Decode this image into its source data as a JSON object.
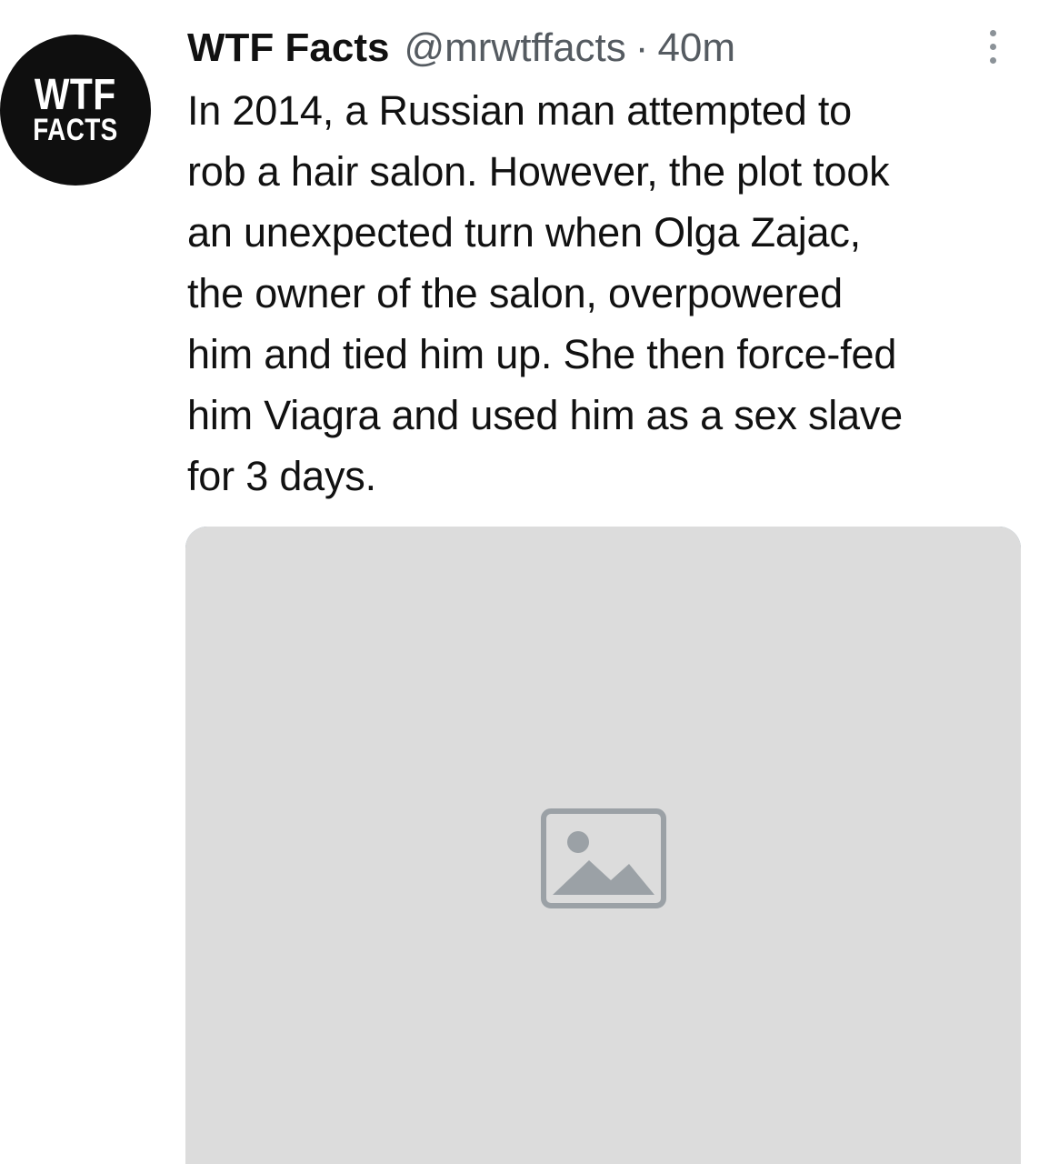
{
  "author": {
    "avatar_line_1": "WTF",
    "avatar_line_2": "FACTS",
    "display_name": "WTF Facts",
    "handle": "@mrwtffacts",
    "separator": "·",
    "timestamp": "40m"
  },
  "tweet": {
    "lines": [
      "In 2014, a Russian man attempted to",
      "rob a hair salon. However, the plot took",
      "an unexpected turn when Olga Zajac,",
      "the owner of the salon, overpowered",
      "him and tied him up. She then force-fed",
      "him Viagra and used him as a sex slave",
      "for 3 days."
    ]
  },
  "media": {
    "icon": "image-icon"
  },
  "colors": {
    "background": "#ffffff",
    "text_primary": "#111111",
    "text_secondary": "#555b61",
    "avatar_background": "#0f0f0f",
    "media_placeholder": "#dcdcdc"
  }
}
